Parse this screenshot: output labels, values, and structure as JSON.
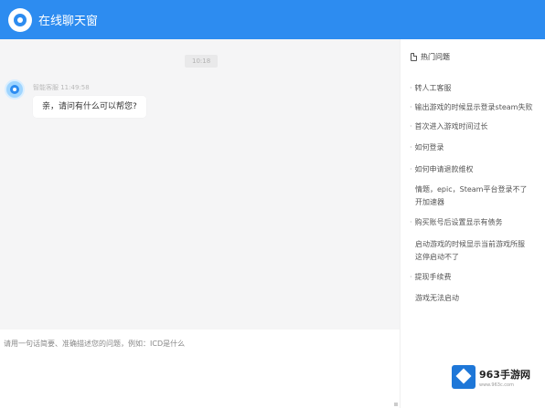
{
  "header": {
    "title": "在线聊天窗"
  },
  "chat": {
    "time_chip": "10:18",
    "messages": [
      {
        "sender": "智能客服  11:49:58",
        "text": "亲，请问有什么可以帮您?"
      }
    ]
  },
  "input": {
    "placeholder": "请用一句话简要、准确描述您的问题，例如：ICD是什么"
  },
  "sidebar": {
    "title": "热门问题",
    "items": [
      "转人工客服",
      "输出游戏的时候显示登录steam失败",
      "首次进入游戏时间过长",
      "如何登录",
      "如何申请退款维权",
      "情题，epic，Steam平台登录不了开加速器",
      "购买账号后设置显示有债务",
      "启动游戏的时候显示当前游戏所服这停启动不了",
      "提现手续费",
      "游戏无法启动"
    ]
  },
  "watermark": {
    "brand": "963手游网",
    "url": "www.963c.com"
  }
}
